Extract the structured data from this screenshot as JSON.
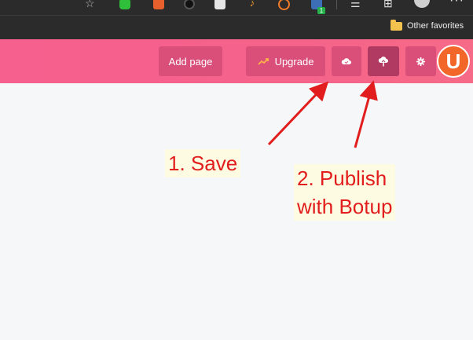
{
  "browser": {
    "favorites_label": "Other favorites",
    "extension_badge_count": "1",
    "more_label": "···"
  },
  "toolbar": {
    "add_page_label": "Add page",
    "upgrade_label": "Upgrade",
    "logo_letter": "U",
    "colors": {
      "bar": "#f5608e",
      "button": "#d94f7a",
      "active_button": "#b13a63",
      "logo": "#f2662a"
    }
  },
  "annotations": {
    "save": "1. Save",
    "publish": "2. Publish\nwith Botup",
    "color": "#e11d1d"
  },
  "icons": {
    "save": "cloud-icon",
    "publish": "cloud-upload-icon",
    "settings": "gear-icon",
    "upgrade": "trend-up-icon"
  }
}
